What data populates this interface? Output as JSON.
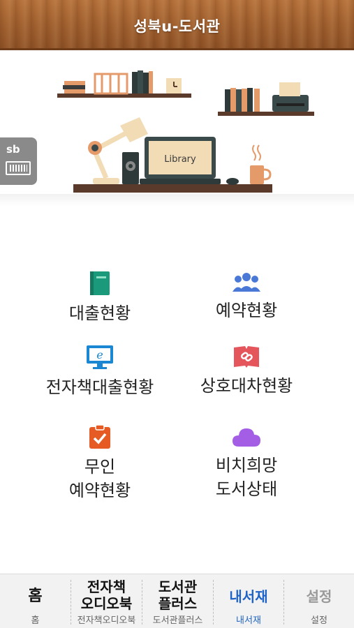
{
  "header": {
    "title": "성북u-도서관"
  },
  "banner": {
    "side_card_label": "sb",
    "laptop_text": "Library"
  },
  "menu": [
    {
      "label": "대출현황",
      "icon": "book-icon",
      "color": "#1a9a7a"
    },
    {
      "label": "예약현황",
      "icon": "users-icon",
      "color": "#4a78d6"
    },
    {
      "label": "전자책대출현황",
      "icon": "e-monitor-icon",
      "color": "#1b86d2"
    },
    {
      "label": "상호대차현황",
      "icon": "link-book-icon",
      "color": "#e4555c"
    },
    {
      "label_line1": "무인",
      "label_line2": "예약현황",
      "icon": "clipboard-check-icon",
      "color": "#e65b23"
    },
    {
      "label_line1": "비치희망",
      "label_line2": "도서상태",
      "icon": "cloud-icon",
      "color": "#a45ee5"
    }
  ],
  "bottom_nav": [
    {
      "main": "홈",
      "sub": "홈"
    },
    {
      "main_line1": "전자책",
      "main_line2": "오디오북",
      "sub": "전자책오디오북"
    },
    {
      "main_line1": "도서관",
      "main_line2": "플러스",
      "sub": "도서관플러스"
    },
    {
      "main": "내서재",
      "sub": "내서재",
      "active": true
    },
    {
      "main": "설정",
      "sub": "설정"
    }
  ],
  "colors": {
    "header_wood": "#a05f2e",
    "active_tab": "#1e63c7"
  }
}
